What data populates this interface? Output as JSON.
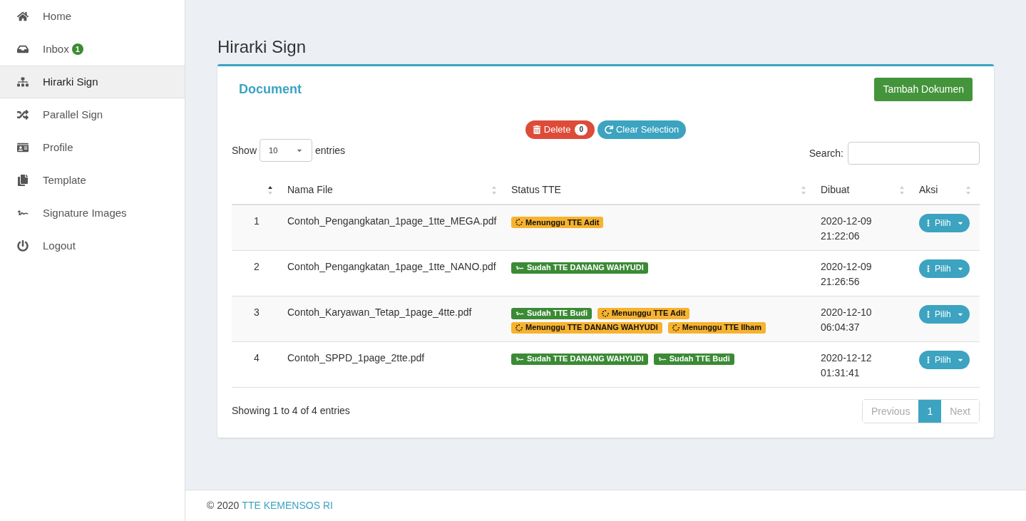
{
  "sidebar": {
    "items": [
      {
        "label": "Home",
        "selected": false
      },
      {
        "label": "Inbox",
        "badge": "1",
        "selected": false
      },
      {
        "label": "Hirarki Sign",
        "selected": true
      },
      {
        "label": "Parallel Sign",
        "selected": false
      },
      {
        "label": "Profile",
        "selected": false
      },
      {
        "label": "Template",
        "selected": false
      },
      {
        "label": "Signature Images",
        "selected": false
      },
      {
        "label": "Logout",
        "selected": false
      }
    ]
  },
  "page_title": "Hirarki Sign",
  "card": {
    "title": "Document",
    "add_button": "Tambah Dokumen",
    "delete_button": {
      "label": "Delete",
      "count": "0"
    },
    "clear_button": "Clear Selection",
    "length": {
      "before": "Show",
      "value": "10",
      "after": "entries"
    },
    "search": {
      "label": "Search:"
    },
    "table": {
      "columns": [
        {
          "sorted": true
        },
        {
          "label": "Nama File",
          "sorted": false
        },
        {
          "label": "Status TTE",
          "sorted": false
        },
        {
          "label": "Dibuat",
          "sorted": false
        },
        {
          "label": "Aksi",
          "sorted": false
        }
      ],
      "rows": [
        {
          "no": "1",
          "file": "Contoh_Pengangkatan_1page_1tte_MEGA.pdf",
          "statuses": [
            {
              "kind": "waiting",
              "label": "Menunggu TTE Adit"
            }
          ],
          "date": "2020-12-09",
          "time": "21:22:06",
          "action": "Pilih"
        },
        {
          "no": "2",
          "file": "Contoh_Pengangkatan_1page_1tte_NANO.pdf",
          "statuses": [
            {
              "kind": "done",
              "label": "Sudah TTE DANANG WAHYUDI"
            }
          ],
          "date": "2020-12-09",
          "time": "21:26:56",
          "action": "Pilih"
        },
        {
          "no": "3",
          "file": "Contoh_Karyawan_Tetap_1page_4tte.pdf",
          "statuses": [
            {
              "kind": "done",
              "label": "Sudah TTE Budi"
            },
            {
              "kind": "waiting",
              "label": "Menunggu TTE Adit"
            },
            {
              "kind": "waiting",
              "label": "Menunggu TTE DANANG WAHYUDI"
            },
            {
              "kind": "waiting",
              "label": "Menunggu TTE Ilham"
            }
          ],
          "date": "2020-12-10",
          "time": "06:04:37",
          "action": "Pilih"
        },
        {
          "no": "4",
          "file": "Contoh_SPPD_1page_2tte.pdf",
          "statuses": [
            {
              "kind": "done",
              "label": "Sudah TTE DANANG WAHYUDI"
            },
            {
              "kind": "done",
              "label": "Sudah TTE Budi"
            }
          ],
          "date": "2020-12-12",
          "time": "01:31:41",
          "action": "Pilih"
        }
      ]
    },
    "info": "Showing 1 to 4 of 4 entries",
    "pagination": {
      "previous": {
        "label": "Previous",
        "disabled": true
      },
      "pages": [
        {
          "label": "1",
          "selected": true
        }
      ],
      "next": {
        "label": "Next",
        "disabled": true
      }
    }
  },
  "footer": {
    "text": "© 2020",
    "link": "TTE KEMENSOS RI"
  }
}
